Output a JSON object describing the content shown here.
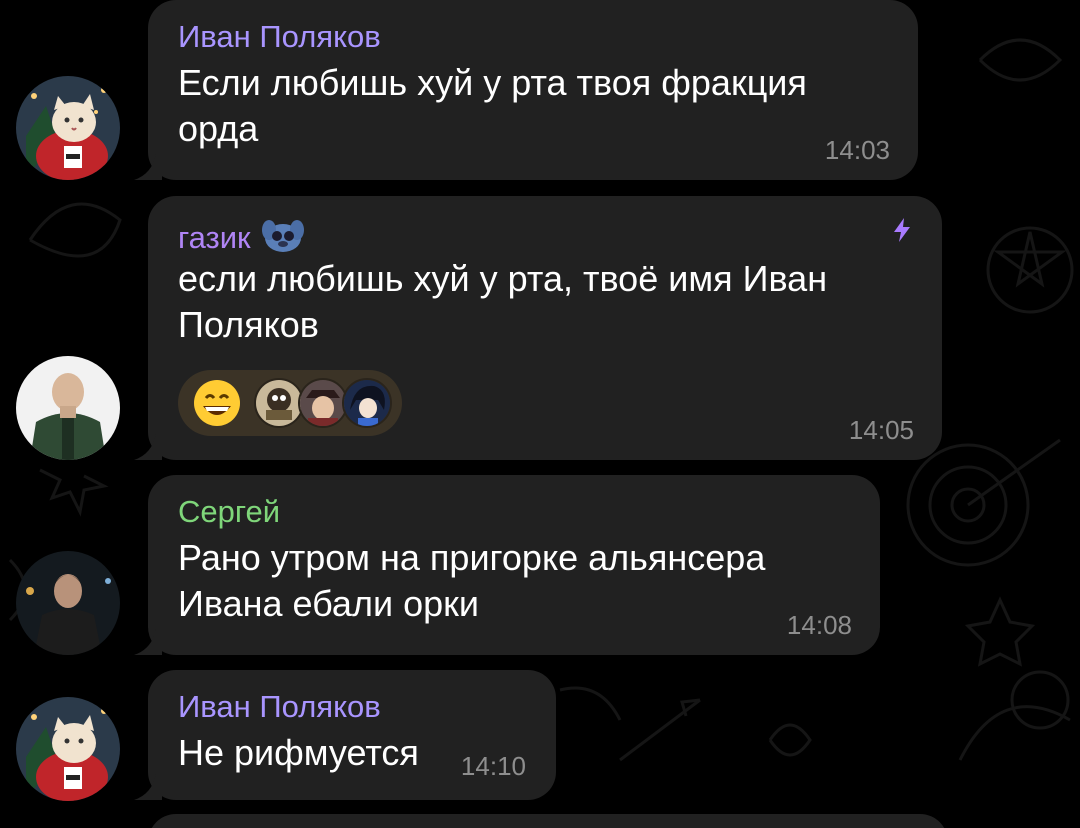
{
  "colors": {
    "background": "#000000",
    "bubble": "#212121",
    "timestamp": "#8e8e8e",
    "text": "#ffffff"
  },
  "messages": [
    {
      "sender": "Иван Поляков",
      "sender_color": "#a995ff",
      "avatar": "cat-in-santa-costume-avatar",
      "text": "Если любишь хуй у рта твоя фракция орда",
      "time": "14:03"
    },
    {
      "sender": "газик",
      "sender_color": "#b085f5",
      "sender_badge": "stitch-sticker-icon",
      "avatar": "bald-man-green-jacket-avatar",
      "boost_icon": "lightning-boost-icon",
      "text": "если любишь хуй у рта, твоё имя Иван Поляков",
      "reaction": {
        "emoji": "grinning-face-emoji",
        "reactors": [
          "reactor-avatar-1",
          "reactor-avatar-2",
          "reactor-avatar-3"
        ]
      },
      "time": "14:05"
    },
    {
      "sender": "Сергей",
      "sender_color": "#7fd67a",
      "avatar": "man-night-street-avatar",
      "text": "Рано утром на пригорке альянсера Ивана ебали орки",
      "time": "14:08"
    },
    {
      "sender": "Иван Поляков",
      "sender_color": "#a995ff",
      "avatar": "cat-in-santa-costume-avatar",
      "text": "Не рифмуется",
      "time": "14:10"
    }
  ]
}
